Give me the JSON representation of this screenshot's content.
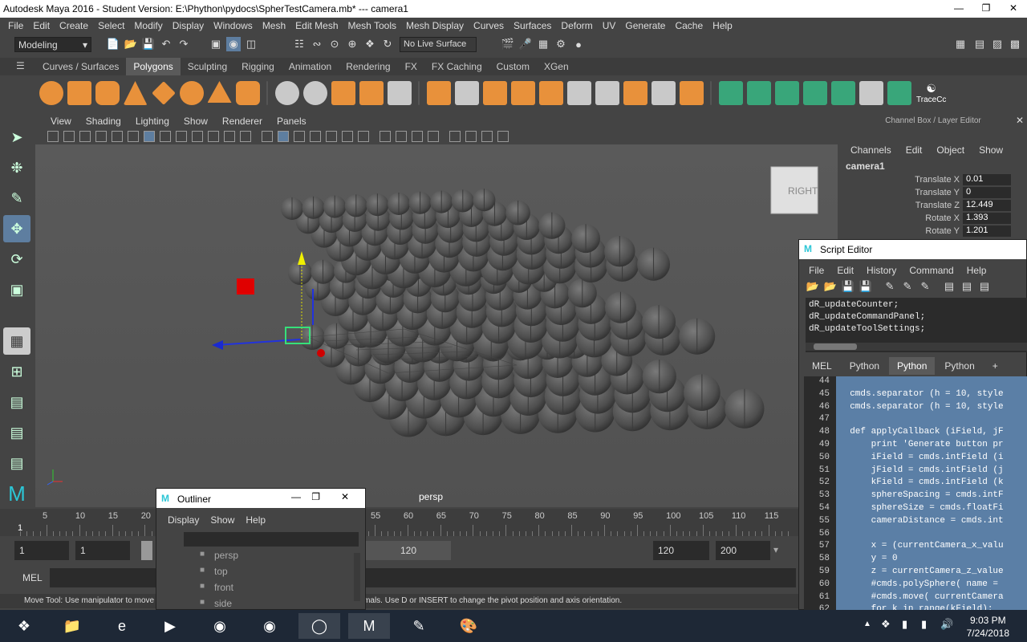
{
  "window": {
    "title": "Autodesk Maya 2016 - Student Version: E:\\Phython\\pydocs\\SpherTestCamera.mb*   ---   camera1"
  },
  "menubar": [
    "File",
    "Edit",
    "Create",
    "Select",
    "Modify",
    "Display",
    "Windows",
    "Mesh",
    "Edit Mesh",
    "Mesh Tools",
    "Mesh Display",
    "Curves",
    "Surfaces",
    "Deform",
    "UV",
    "Generate",
    "Cache",
    "Help"
  ],
  "statusline": {
    "mode": "Modeling",
    "live_surface": "No Live Surface"
  },
  "shelf_tabs": [
    "Curves / Surfaces",
    "Polygons",
    "Sculpting",
    "Rigging",
    "Animation",
    "Rendering",
    "FX",
    "FX Caching",
    "Custom",
    "XGen"
  ],
  "shelf_active": "Polygons",
  "shelf_extra_label": "TraceCc",
  "viewport": {
    "menu": [
      "View",
      "Shading",
      "Lighting",
      "Show",
      "Renderer",
      "Panels"
    ],
    "camera_label": "persp",
    "viewcube_label": "RIGHT"
  },
  "channel_box": {
    "header": "Channel Box / Layer Editor",
    "menu": [
      "Channels",
      "Edit",
      "Object",
      "Show"
    ],
    "object": "camera1",
    "attributes": [
      {
        "name": "Translate X",
        "value": "0.01"
      },
      {
        "name": "Translate Y",
        "value": "0"
      },
      {
        "name": "Translate Z",
        "value": "12.449"
      },
      {
        "name": "Rotate X",
        "value": "1.393"
      },
      {
        "name": "Rotate Y",
        "value": "1.201"
      }
    ]
  },
  "script_editor": {
    "title": "Script Editor",
    "menu": [
      "File",
      "Edit",
      "History",
      "Command",
      "Help"
    ],
    "output_lines": [
      "dR_updateCounter;",
      "dR_updateCommandPanel;",
      "dR_updateToolSettings;"
    ],
    "tabs": [
      "MEL",
      "Python",
      "Python",
      "Python",
      "+"
    ],
    "active_tab": 2,
    "code": [
      {
        "ln": "44",
        "text": ""
      },
      {
        "ln": "45",
        "text": "  cmds.separator (h = 10, style"
      },
      {
        "ln": "46",
        "text": "  cmds.separator (h = 10, style"
      },
      {
        "ln": "47",
        "text": ""
      },
      {
        "ln": "48",
        "text": "  def applyCallback (iField, jF"
      },
      {
        "ln": "49",
        "text": "      print 'Generate button pr"
      },
      {
        "ln": "50",
        "text": "      iField = cmds.intField (i"
      },
      {
        "ln": "51",
        "text": "      jField = cmds.intField (j"
      },
      {
        "ln": "52",
        "text": "      kField = cmds.intField (k"
      },
      {
        "ln": "53",
        "text": "      sphereSpacing = cmds.intF"
      },
      {
        "ln": "54",
        "text": "      sphereSize = cmds.floatFi"
      },
      {
        "ln": "55",
        "text": "      cameraDistance = cmds.int"
      },
      {
        "ln": "56",
        "text": ""
      },
      {
        "ln": "57",
        "text": "      x = (currentCamera_x_valu"
      },
      {
        "ln": "58",
        "text": "      y = 0"
      },
      {
        "ln": "59",
        "text": "      z = currentCamera_z_value"
      },
      {
        "ln": "60",
        "text": "      #cmds.polySphere( name = "
      },
      {
        "ln": "61",
        "text": "      #cmds.move( currentCamera"
      },
      {
        "ln": "62",
        "text": "      for k in range(kField):"
      }
    ]
  },
  "outliner": {
    "title": "Outliner",
    "menu": [
      "Display",
      "Show",
      "Help"
    ],
    "items": [
      "persp",
      "top",
      "front",
      "side"
    ]
  },
  "timeline": {
    "ticks": [
      "5",
      "10",
      "15",
      "20",
      "25",
      "30",
      "35",
      "40",
      "45",
      "50",
      "55",
      "60",
      "65",
      "70",
      "75",
      "80",
      "85",
      "90",
      "95",
      "100",
      "105",
      "110",
      "115"
    ],
    "current": "1"
  },
  "range": {
    "start": "1",
    "start2": "1",
    "end_slider": "120",
    "end": "120",
    "end2": "200"
  },
  "mel": {
    "label": "MEL"
  },
  "help_line": "Move Tool: Use manipulator to move object(s). Ctrl+middle-drag to move components along normals. Use D or INSERT to change the pivot position and axis orientation.",
  "clock": {
    "time": "9:03 PM",
    "date": "7/24/2018"
  }
}
